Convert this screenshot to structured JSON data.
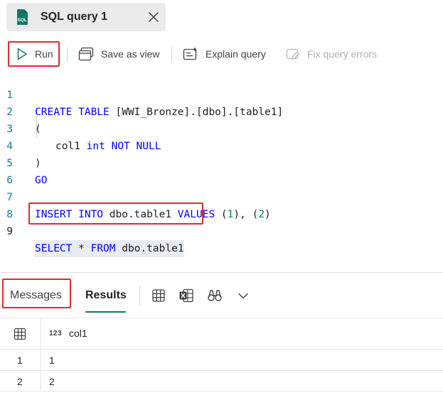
{
  "tab": {
    "title": "SQL query 1",
    "icon_text": "SQL"
  },
  "toolbar": {
    "run_label": "Run",
    "save_as_view_label": "Save as view",
    "explain_query_label": "Explain query",
    "fix_query_errors_label": "Fix query errors"
  },
  "editor": {
    "line_numbers": [
      "1",
      "2",
      "3",
      "4",
      "5",
      "6",
      "7",
      "8",
      "9"
    ],
    "l1_kw": "CREATE TABLE",
    "l1_rest": " [WWI_Bronze].[dbo].[table1]",
    "l2": "(",
    "l3_ident": "col1",
    "l3_type": "int",
    "l3_not_null": "NOT NULL",
    "l4": ")",
    "l5_kw": "GO",
    "l7_kw1": "INSERT INTO",
    "l7_table": " dbo.table1 ",
    "l7_kw2": "VALUES",
    "l7_open1": " (",
    "l7_num1": "1",
    "l7_sep": "), (",
    "l7_num2": "2",
    "l7_close": ")",
    "l9_kw1": "SELECT",
    "l9_star": " * ",
    "l9_kw2": "FROM",
    "l9_table": " dbo.table1"
  },
  "results_panel": {
    "messages_tab": "Messages",
    "results_tab": "Results",
    "column_type_label": "123",
    "columns": [
      "col1"
    ],
    "rows": [
      {
        "row_number": "1",
        "values": [
          "1"
        ]
      },
      {
        "row_number": "2",
        "values": [
          "2"
        ]
      }
    ]
  },
  "colors": {
    "keyword": "#0000ff",
    "number": "#098658",
    "line_number": "#237893",
    "accent": "#117865",
    "highlight_border": "#e12b2b"
  }
}
